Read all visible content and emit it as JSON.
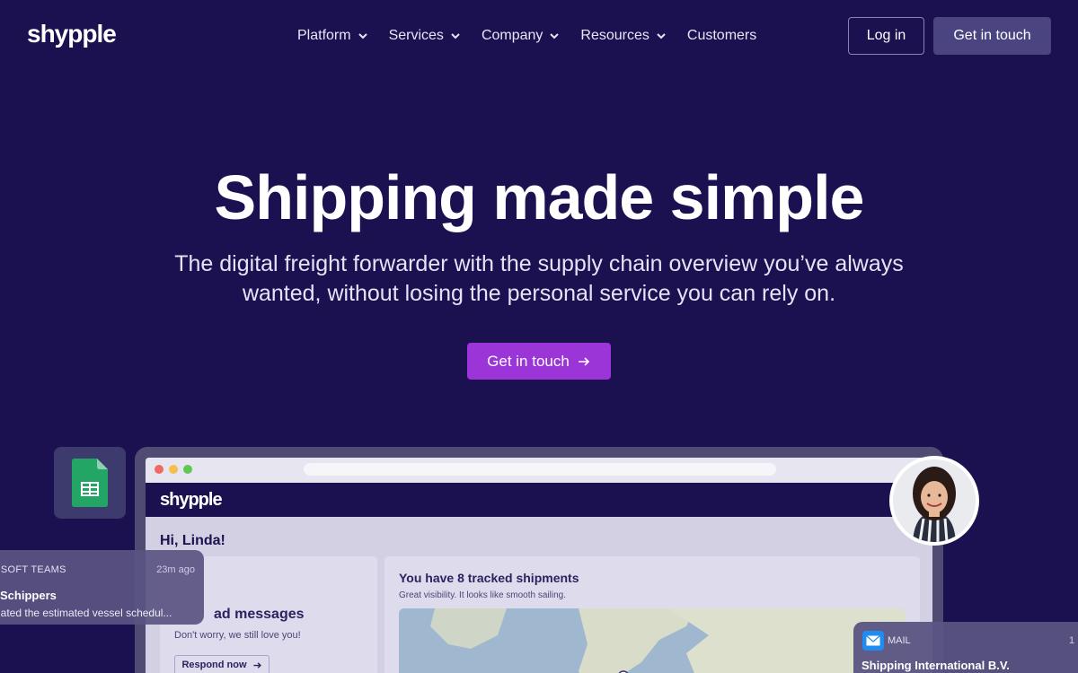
{
  "header": {
    "logo": "shypple",
    "nav": [
      {
        "label": "Platform",
        "has_dropdown": true
      },
      {
        "label": "Services",
        "has_dropdown": true
      },
      {
        "label": "Company",
        "has_dropdown": true
      },
      {
        "label": "Resources",
        "has_dropdown": true
      },
      {
        "label": "Customers",
        "has_dropdown": false
      }
    ],
    "login_label": "Log in",
    "cta_label": "Get in touch"
  },
  "hero": {
    "title": "Shipping made simple",
    "subtitle_line1": "The digital freight forwarder with the supply chain overview you’ve always",
    "subtitle_line2": "wanted, without losing the personal service you can rely on.",
    "cta_label": "Get in touch"
  },
  "mockup": {
    "app_logo": "shypple",
    "greeting": "Hi, Linda!",
    "messages_title": "ad messages",
    "messages_sub": "Don't worry, we still love you!",
    "respond_label": "Respond now",
    "tracked_title": "You have 8 tracked shipments",
    "tracked_sub": "Great visibility. It looks like smooth sailing."
  },
  "notifications": {
    "teams": {
      "app": "OSOFT TEAMS",
      "time": "23m ago",
      "title": "Schippers",
      "body": "dated the estimated vessel schedul..."
    },
    "mail": {
      "app": "MAIL",
      "time": "1",
      "title": "Shipping International B.V."
    }
  },
  "colors": {
    "background": "#1b1050",
    "cta_purple": "#9b35d8",
    "secondary_button": "#4a4580",
    "sheets_green": "#23a566"
  },
  "icons": [
    "chevron-down-icon",
    "arrow-right-icon",
    "google-sheets-icon",
    "mail-icon"
  ]
}
